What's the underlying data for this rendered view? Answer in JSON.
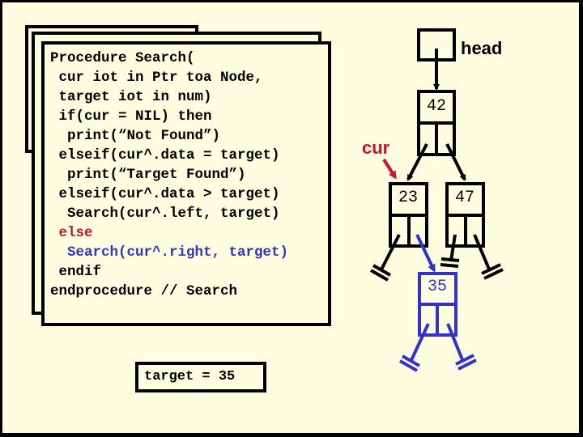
{
  "code": {
    "ghost_line": "Procedure Search(",
    "lines": [
      {
        "text": "Procedure Search(",
        "color": "black"
      },
      {
        "text": " cur iot in Ptr toa Node,",
        "color": "black"
      },
      {
        "text": " target iot in num)",
        "color": "black"
      },
      {
        "text": " if(cur = NIL) then",
        "color": "black"
      },
      {
        "text": "  print(“Not Found”)",
        "color": "black"
      },
      {
        "text": " elseif(cur^.data = target)",
        "color": "black"
      },
      {
        "text": "  print(“Target Found”)",
        "color": "black"
      },
      {
        "text": " elseif(cur^.data > target)",
        "color": "black"
      },
      {
        "text": "  Search(cur^.left, target)",
        "color": "black"
      },
      {
        "text": " else",
        "color": "red"
      },
      {
        "text": "  Search(cur^.right, target)",
        "color": "blue"
      },
      {
        "text": " endif",
        "color": "black"
      },
      {
        "text": "endprocedure // Search",
        "color": "black"
      }
    ]
  },
  "target_label": "target = 35",
  "tree": {
    "head_label": "head",
    "cur_label": "cur",
    "nodes": [
      {
        "id": "n42",
        "value": "42",
        "color": "#000000"
      },
      {
        "id": "n23",
        "value": "23",
        "color": "#000000"
      },
      {
        "id": "n47",
        "value": "47",
        "color": "#000000"
      },
      {
        "id": "n35",
        "value": "35",
        "color": "#3333cc"
      }
    ]
  },
  "colors": {
    "background": "#fdfde0",
    "highlight_red": "#cc1133",
    "highlight_blue": "#3333cc"
  }
}
